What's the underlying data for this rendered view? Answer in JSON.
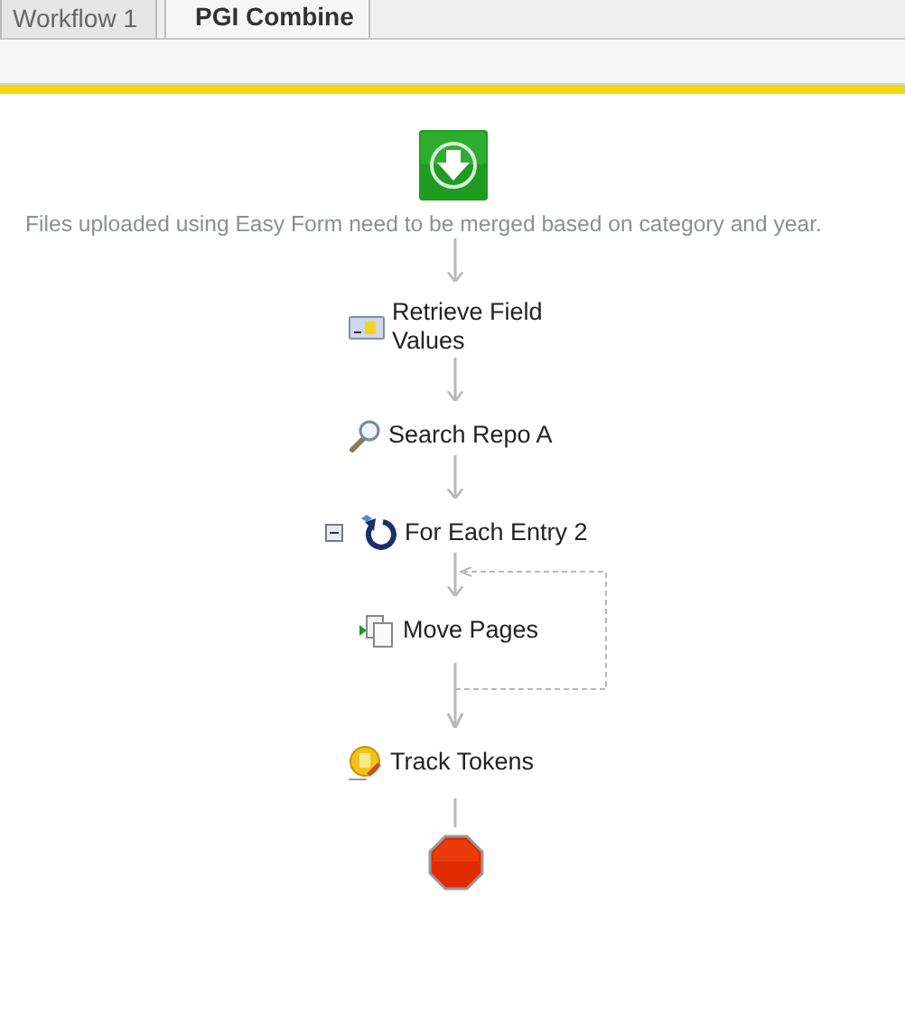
{
  "tabs": [
    {
      "label": "Workflow 1",
      "selected": false
    },
    {
      "label": "PGI Combine",
      "selected": true
    }
  ],
  "workflow": {
    "description": "Files uploaded using Easy Form need to be merged based on category and year.",
    "steps": [
      {
        "kind": "retrieve",
        "label": "Retrieve Field Values"
      },
      {
        "kind": "search",
        "label": "Search Repo A"
      },
      {
        "kind": "foreach",
        "label": "For Each Entry 2",
        "expanded": true,
        "children": [
          {
            "kind": "move",
            "label": "Move Pages"
          }
        ]
      },
      {
        "kind": "token",
        "label": "Track Tokens"
      }
    ]
  }
}
